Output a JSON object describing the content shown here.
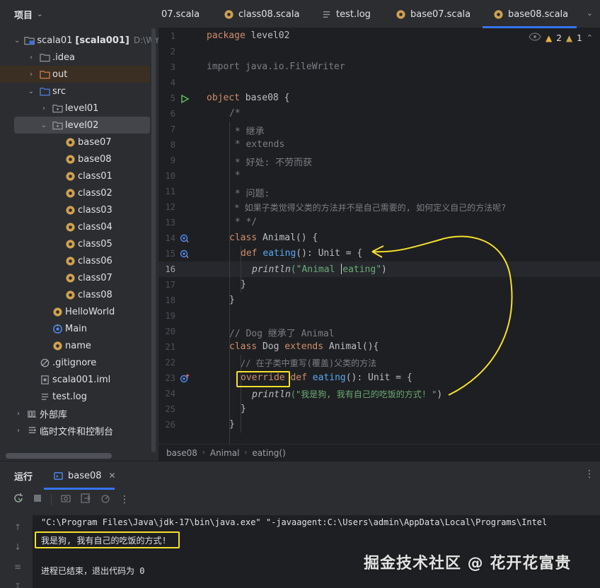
{
  "project": {
    "title": "项目",
    "tree": [
      {
        "label": "scala01",
        "bold": "[scala001]",
        "muted": "D:\\WYM"
      },
      {
        "label": ".idea"
      },
      {
        "label": "out"
      },
      {
        "label": "src"
      },
      {
        "label": "level01"
      },
      {
        "label": "level02"
      },
      {
        "label": "base07"
      },
      {
        "label": "base08"
      },
      {
        "label": "class01"
      },
      {
        "label": "class02"
      },
      {
        "label": "class03"
      },
      {
        "label": "class04"
      },
      {
        "label": "class05"
      },
      {
        "label": "class06"
      },
      {
        "label": "class07"
      },
      {
        "label": "class08"
      },
      {
        "label": "HelloWorld"
      },
      {
        "label": "Main"
      },
      {
        "label": "name"
      },
      {
        "label": ".gitignore"
      },
      {
        "label": "scala001.iml"
      },
      {
        "label": "test.log"
      },
      {
        "label": "外部库"
      },
      {
        "label": "临时文件和控制台"
      }
    ]
  },
  "tabs": [
    {
      "label": "07.scala"
    },
    {
      "label": "class08.scala"
    },
    {
      "label": "test.log"
    },
    {
      "label": "base07.scala"
    },
    {
      "label": "base08.scala"
    }
  ],
  "inspections": {
    "warnings": "2",
    "weak": "1"
  },
  "editor": {
    "line_numbers": [
      "1",
      "2",
      "3",
      "4",
      "5",
      "6",
      "7",
      "8",
      "9",
      "10",
      "11",
      "12",
      "13",
      "14",
      "15",
      "16",
      "17",
      "18",
      "19",
      "20",
      "21",
      "22",
      "23",
      "24",
      "25",
      "26"
    ],
    "code": {
      "l1_kw": "package",
      "l1_rest": " level02",
      "l3_kw": "import",
      "l3_rest": " java.io.FileWriter",
      "l5_kw": "object",
      "l5_rest": " base08 {",
      "l6": "/*",
      "l7": " * 继承",
      "l8": " * extends",
      "l9": " * 好处: 不劳而获",
      "l10": " *",
      "l11": " * 问题:",
      "l12": " * 如果子类觉得父类的方法并不是自己需要的, 如何定义自己的方法呢?",
      "l13": " * */",
      "l14_kw": "class",
      "l14_rest": " Animal() {",
      "l15_kw": "def",
      "l15_fn": "eating",
      "l15_rest": "(): Unit = {",
      "l16_fn": "println",
      "l16_str_a": "(\"Animal ",
      "l16_str_b": "eating\"",
      "l16_close": ")",
      "l17": "}",
      "l18": "}",
      "l20": "// Dog 继承了 Animal",
      "l21_kw": "class",
      "l21_name": " Dog ",
      "l21_kw2": "extends",
      "l21_rest": " Animal(){",
      "l22": "// 在子类中重写(覆盖)父类的方法",
      "l23_kw": "override",
      "l23_kw2": "def",
      "l23_fn": "eating",
      "l23_rest": "(): Unit = {",
      "l24_fn": "println",
      "l24_str": "(\"我是狗, 我有自己的吃饭的方式! \"",
      "l24_close": ")",
      "l25": "}",
      "l26": "}"
    }
  },
  "breadcrumb": [
    "base08",
    "Animal",
    "eating()"
  ],
  "run": {
    "title": "运行",
    "tab": "base08",
    "console": [
      "\"C:\\Program Files\\Java\\jdk-17\\bin\\java.exe\" \"-javaagent:C:\\Users\\admin\\AppData\\Local\\Programs\\Intel",
      "我是狗, 我有自己的吃饭的方式!",
      "进程已结束，退出代码为 0"
    ]
  },
  "watermark": "掘金技术社区 @ 花开花富贵",
  "colors": {
    "keyword": "#cf8e6d",
    "function": "#56a8f5",
    "string": "#6aab73",
    "comment": "#7a7e85",
    "accent": "#3574f0",
    "annotation": "#f5e02c"
  }
}
